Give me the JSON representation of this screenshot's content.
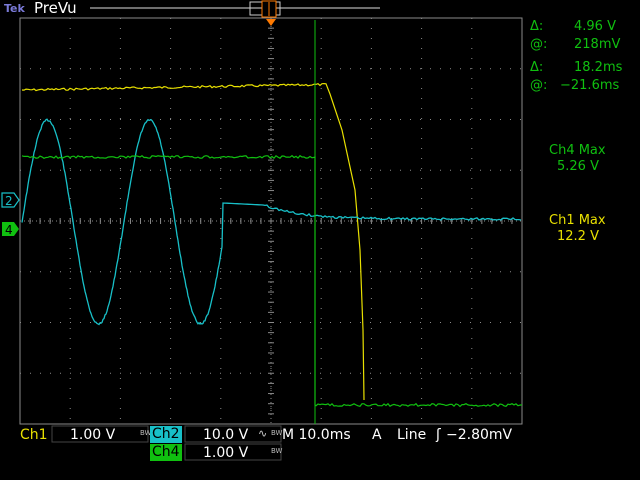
{
  "header": {
    "brand": "Tek",
    "mode": "PreVu"
  },
  "readouts": {
    "delta_v_symbol": "Δ:",
    "delta_v": "4.96 V",
    "at_v_symbol": "@:",
    "at_v": "218mV",
    "delta_t_symbol": "Δ:",
    "delta_t": "18.2ms",
    "at_t_symbol": "@:",
    "at_t": "−21.6ms",
    "ch4_max_label": "Ch4 Max",
    "ch4_max_value": "5.26 V",
    "ch1_max_label": "Ch1 Max",
    "ch1_max_value": "12.2 V"
  },
  "status": {
    "ch1_label": "Ch1",
    "ch1_scale": "1.00 V",
    "ch1_bw": "BW",
    "ch2_label": "Ch2",
    "ch2_scale": "10.0 V",
    "ch2_bw": "BW",
    "timebase": "M 10.0ms",
    "trigger_source_label": "A",
    "trigger_source": "Line",
    "trigger_level": "−2.80mV",
    "ch4_label": "Ch4",
    "ch4_scale": "1.00 V",
    "ch4_bw": "BW"
  },
  "markers": {
    "ch2_marker": "2",
    "ch4_marker": "4"
  },
  "colors": {
    "ch1": "#e8e000",
    "ch2": "#18c0c8",
    "ch4": "#10c010",
    "grid": "#8a8a8a",
    "cursor": "#10c010",
    "trigger": "#ff8000"
  }
}
